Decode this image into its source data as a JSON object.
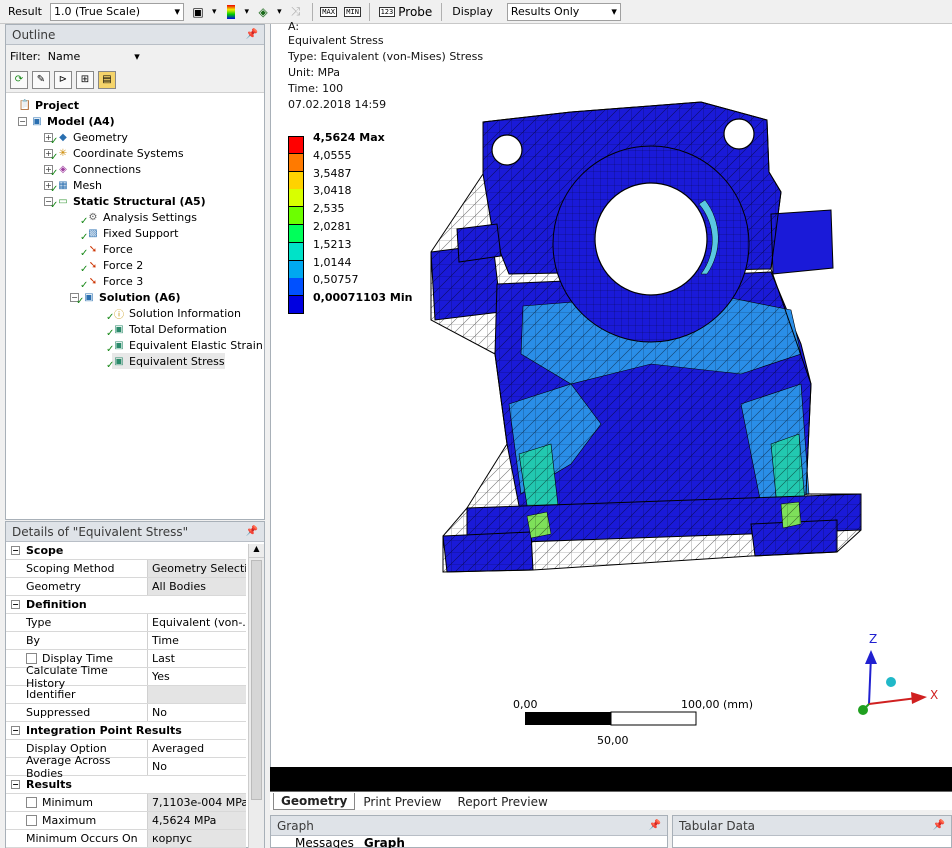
{
  "toolbar": {
    "result_label": "Result",
    "scale_value": "1.0 (True Scale)",
    "max_label": "MAX",
    "min_label": "MIN",
    "probe_label": "Probe",
    "probe_badge": "123",
    "display_label": "Display",
    "display_value": "Results Only"
  },
  "outline": {
    "title": "Outline",
    "filter_label": "Filter:",
    "filter_value": "Name",
    "tree": {
      "project": "Project",
      "model": "Model (A4)",
      "geometry": "Geometry",
      "coord": "Coordinate Systems",
      "connections": "Connections",
      "mesh": "Mesh",
      "static": "Static Structural (A5)",
      "analysis": "Analysis Settings",
      "fixed": "Fixed Support",
      "force": "Force",
      "force2": "Force 2",
      "force3": "Force 3",
      "solution": "Solution (A6)",
      "solinfo": "Solution Information",
      "totdef": "Total Deformation",
      "elastic": "Equivalent Elastic Strain",
      "eqstress": "Equivalent Stress"
    }
  },
  "details": {
    "title": "Details of \"Equivalent Stress\"",
    "scope": "Scope",
    "scoping_method_k": "Scoping Method",
    "scoping_method_v": "Geometry Selecti...",
    "geometry_k": "Geometry",
    "geometry_v": "All Bodies",
    "definition": "Definition",
    "type_k": "Type",
    "type_v": "Equivalent (von-...",
    "by_k": "By",
    "by_v": "Time",
    "display_time_k": "Display Time",
    "display_time_v": "Last",
    "calc_hist_k": "Calculate Time History",
    "calc_hist_v": "Yes",
    "identifier_k": "Identifier",
    "identifier_v": "",
    "suppressed_k": "Suppressed",
    "suppressed_v": "No",
    "ipr": "Integration Point Results",
    "display_opt_k": "Display Option",
    "display_opt_v": "Averaged",
    "avg_bodies_k": "Average Across Bodies",
    "avg_bodies_v": "No",
    "results": "Results",
    "minimum_k": "Minimum",
    "minimum_v": "7,1103e-004 MPa",
    "maximum_k": "Maximum",
    "maximum_v": "4,5624 MPa",
    "min_occurs_k": "Minimum Occurs On",
    "min_occurs_v": "корпус"
  },
  "viewport": {
    "header_top": "A:",
    "title": "Equivalent Stress",
    "type_line": "Type: Equivalent (von-Mises) Stress",
    "unit_line": "Unit: MPa",
    "time_line": "Time: 100",
    "date_line": "07.02.2018 14:59",
    "legend": [
      {
        "label": "4,5624 Max",
        "color": "#ff0000",
        "bold": true
      },
      {
        "label": "4,0555",
        "color": "#ff7a00",
        "bold": false
      },
      {
        "label": "3,5487",
        "color": "#ffd200",
        "bold": false
      },
      {
        "label": "3,0418",
        "color": "#d8ff00",
        "bold": false
      },
      {
        "label": "2,535",
        "color": "#6cff00",
        "bold": false
      },
      {
        "label": "2,0281",
        "color": "#00ff5a",
        "bold": false
      },
      {
        "label": "1,5213",
        "color": "#00e2c8",
        "bold": false
      },
      {
        "label": "1,0144",
        "color": "#00a8f0",
        "bold": false
      },
      {
        "label": "0,50757",
        "color": "#0050ff",
        "bold": false
      },
      {
        "label": "0,00071103 Min",
        "color": "#0000e0",
        "bold": true
      }
    ],
    "scale_left": "0,00",
    "scale_right": "100,00 (mm)",
    "scale_mid": "50,00",
    "axis_z": "Z",
    "axis_x": "X"
  },
  "tabs": [
    "Geometry",
    "Print Preview",
    "Report Preview"
  ],
  "graph": {
    "title": "Graph",
    "tab_messages": "Messages",
    "tab_graph": "Graph"
  },
  "tabular": {
    "title": "Tabular Data"
  }
}
